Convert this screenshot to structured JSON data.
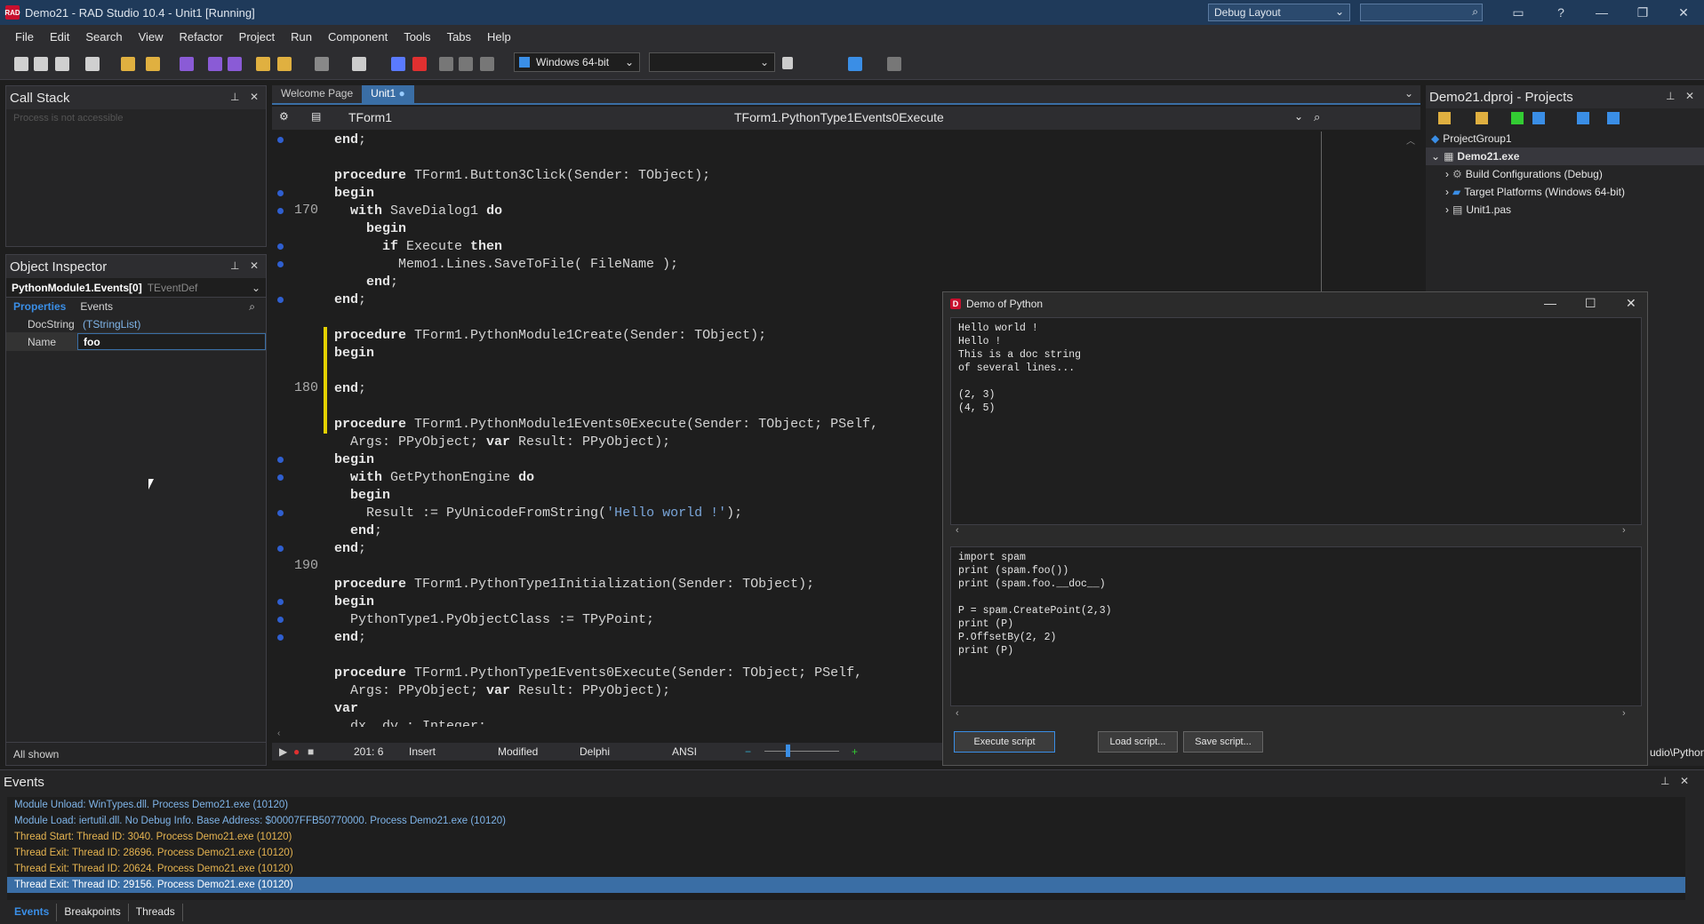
{
  "window": {
    "title": "Demo21 - RAD Studio 10.4 - Unit1 [Running]",
    "layout": "Debug Layout",
    "search_placeholder": ""
  },
  "menu": [
    "File",
    "Edit",
    "Search",
    "View",
    "Refactor",
    "Project",
    "Run",
    "Component",
    "Tools",
    "Tabs",
    "Help"
  ],
  "toolbar": {
    "platform": "Windows 64-bit",
    "config": ""
  },
  "call_stack": {
    "title": "Call Stack",
    "status": "Process is not accessible"
  },
  "object_inspector": {
    "title": "Object Inspector",
    "selected": "PythonModule1.Events[0]",
    "selected_type": "TEventDef",
    "tab_properties": "Properties",
    "tab_events": "Events",
    "rows": [
      {
        "key": "DocString",
        "value": "(TStringList)"
      },
      {
        "key": "Name",
        "value": "foo"
      }
    ],
    "footer": "All shown"
  },
  "editor": {
    "tabs": [
      "Welcome Page",
      "Unit1"
    ],
    "nav_left": "TForm1",
    "nav_right": "TForm1.PythonType1Events0Execute"
  },
  "code": {
    "lines": [
      {
        "n": "",
        "t": "end;"
      },
      {
        "n": "",
        "t": ""
      },
      {
        "n": "",
        "t": "procedure TForm1.Button3Click(Sender: TObject);"
      },
      {
        "n": "",
        "t": "begin"
      },
      {
        "n": "170",
        "t": "  with SaveDialog1 do"
      },
      {
        "n": "",
        "t": "    begin"
      },
      {
        "n": "",
        "t": "      if Execute then"
      },
      {
        "n": "",
        "t": "        Memo1.Lines.SaveToFile( FileName );"
      },
      {
        "n": "",
        "t": "    end;"
      },
      {
        "n": "",
        "t": "end;"
      },
      {
        "n": "",
        "t": ""
      },
      {
        "n": "",
        "t": "procedure TForm1.PythonModule1Create(Sender: TObject);"
      },
      {
        "n": "",
        "t": "begin"
      },
      {
        "n": "",
        "t": ""
      },
      {
        "n": "180",
        "t": "end;"
      },
      {
        "n": "",
        "t": ""
      },
      {
        "n": "",
        "t": "procedure TForm1.PythonModule1Events0Execute(Sender: TObject; PSelf,"
      },
      {
        "n": "",
        "t": "  Args: PPyObject; var Result: PPyObject);"
      },
      {
        "n": "",
        "t": "begin"
      },
      {
        "n": "",
        "t": "  with GetPythonEngine do"
      },
      {
        "n": "",
        "t": "  begin"
      },
      {
        "n": "",
        "t": "    Result := PyUnicodeFromString('Hello world !');"
      },
      {
        "n": "",
        "t": "  end;"
      },
      {
        "n": "",
        "t": "end;"
      },
      {
        "n": "190",
        "t": ""
      },
      {
        "n": "",
        "t": "procedure TForm1.PythonType1Initialization(Sender: TObject);"
      },
      {
        "n": "",
        "t": "begin"
      },
      {
        "n": "",
        "t": "  PythonType1.PyObjectClass := TPyPoint;"
      },
      {
        "n": "",
        "t": "end;"
      },
      {
        "n": "",
        "t": ""
      },
      {
        "n": "",
        "t": "procedure TForm1.PythonType1Events0Execute(Sender: TObject; PSelf,"
      },
      {
        "n": "",
        "t": "  Args: PPyObject; var Result: PPyObject);"
      },
      {
        "n": "",
        "t": "var"
      },
      {
        "n": "",
        "t": "  dx, dy : Integer;"
      }
    ]
  },
  "status": {
    "pos": "201:  6",
    "mode": "Insert",
    "state": "Modified",
    "lang": "Delphi",
    "enc": "ANSI"
  },
  "python_dialog": {
    "title": "Demo of Python",
    "output": "Hello world !\nHello !\nThis is a doc string\nof several lines...\n\n(2, 3)\n(4, 5)",
    "script": "import spam\nprint (spam.foo())\nprint (spam.foo.__doc__)\n\nP = spam.CreatePoint(2,3)\nprint (P)\nP.OffsetBy(2, 2)\nprint (P)",
    "btn_execute": "Execute script",
    "btn_load": "Load script...",
    "btn_save": "Save script..."
  },
  "projects": {
    "title": "Demo21.dproj - Projects",
    "group": "ProjectGroup1",
    "exe": "Demo21.exe",
    "items": [
      "Build Configurations (Debug)",
      "Target Platforms (Windows 64-bit)",
      "Unit1.pas"
    ],
    "path_tail": "udio\\Python"
  },
  "events": {
    "title": "Events",
    "lines": [
      {
        "t": "Module Unload: WinTypes.dll. Process Demo21.exe (10120)",
        "c": "#7fb4e8"
      },
      {
        "t": "Module Load: iertutil.dll. No Debug Info. Base Address: $00007FFB50770000. Process Demo21.exe (10120)",
        "c": "#7fb4e8"
      },
      {
        "t": "Thread Start: Thread ID: 3040. Process Demo21.exe (10120)",
        "c": "#e6b450"
      },
      {
        "t": "Thread Exit: Thread ID: 28696. Process Demo21.exe (10120)",
        "c": "#e6b450"
      },
      {
        "t": "Thread Exit: Thread ID: 20624. Process Demo21.exe (10120)",
        "c": "#e6b450"
      },
      {
        "t": "Thread Exit: Thread ID: 29156. Process Demo21.exe (10120)",
        "c": "#ffffff"
      }
    ],
    "tabs": [
      "Events",
      "Breakpoints",
      "Threads"
    ]
  }
}
